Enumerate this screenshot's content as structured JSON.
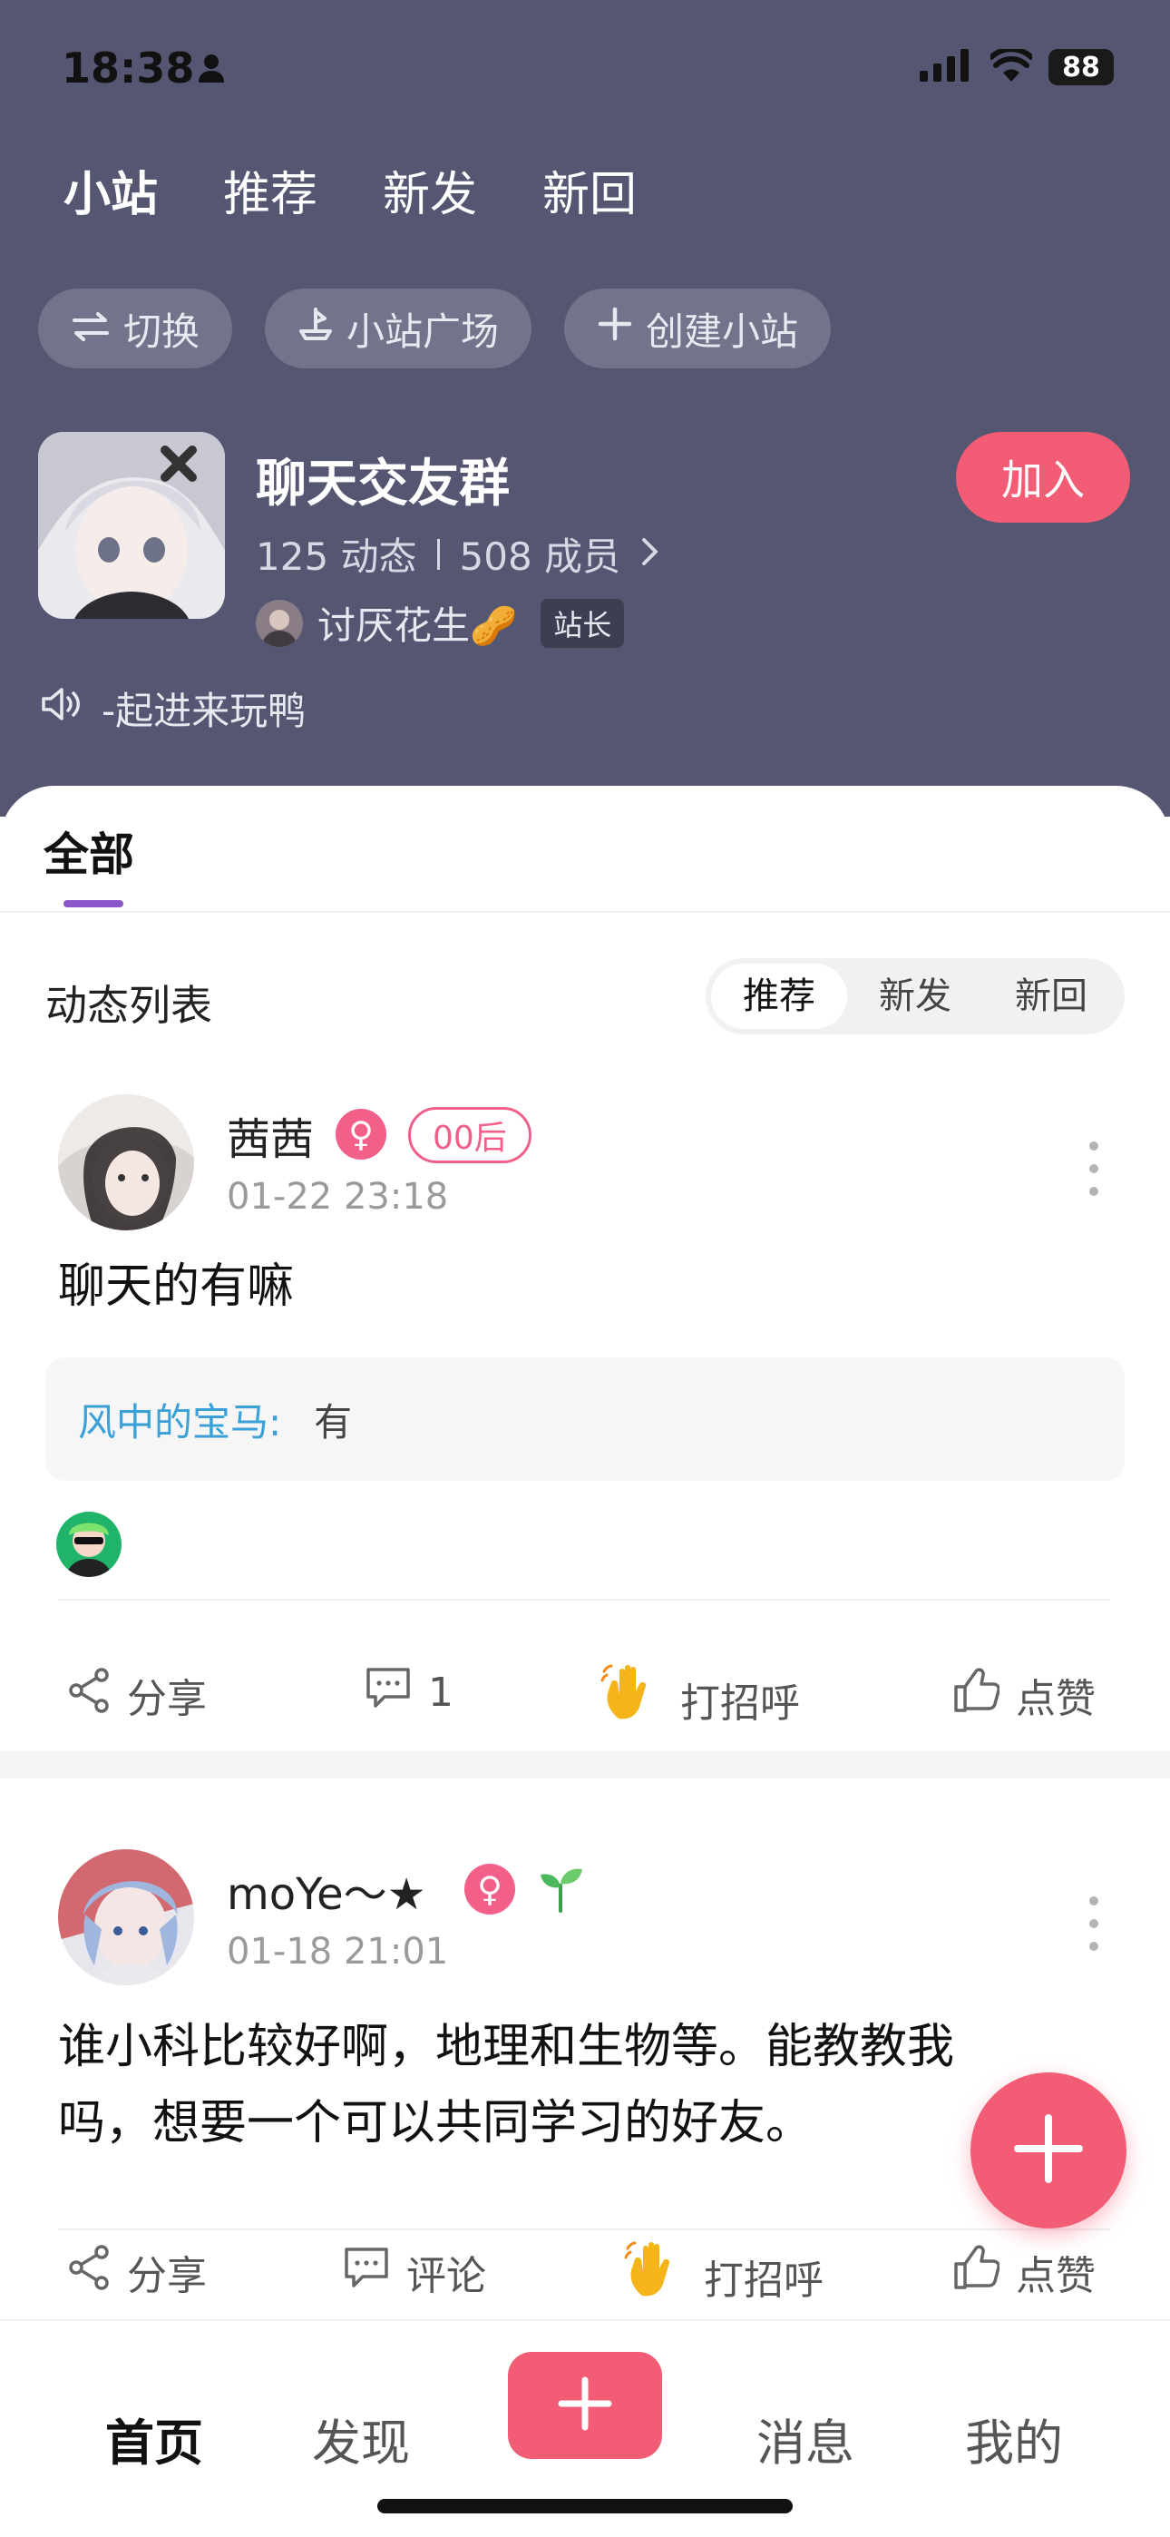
{
  "status_bar": {
    "time": "18:38",
    "battery": "88"
  },
  "top_tabs": [
    {
      "label": "小站"
    },
    {
      "label": "推荐"
    },
    {
      "label": "新发"
    },
    {
      "label": "新回"
    }
  ],
  "pills": [
    {
      "label": "切换",
      "icon": "swap-icon"
    },
    {
      "label": "小站广场",
      "icon": "ship-icon"
    },
    {
      "label": "创建小站",
      "icon": "plus-icon"
    }
  ],
  "group": {
    "title": "聊天交友群",
    "posts_count": "125 动态",
    "members_count": "508 成员",
    "owner_name": "讨厌花生🥜",
    "owner_badge": "站长",
    "join_label": "加入",
    "announcement": "-起进来玩鸭"
  },
  "content_tabs": {
    "all_label": "全部"
  },
  "feed": {
    "label": "动态列表",
    "sort_options": [
      "推荐",
      "新发",
      "新回"
    ],
    "selected_sort": "推荐"
  },
  "posts": [
    {
      "name": "茜茜",
      "gender_symbol": "♀",
      "age_tag": "00后",
      "time": "01-22 23:18",
      "text": "聊天的有嘛",
      "reply": {
        "name": "风中的宝马:",
        "text": "有"
      },
      "actions": {
        "share": "分享",
        "comment": "1",
        "greet": "打招呼",
        "like": "点赞"
      }
    },
    {
      "name": "moYe～★",
      "gender_symbol": "♀",
      "time": "01-18 21:01",
      "text_line1": "谁小科比较好啊，地理和生物等。能教教我",
      "text_line2": "吗，想要一个可以共同学习的好友。",
      "actions": {
        "share": "分享",
        "comment": "评论",
        "greet": "打招呼",
        "like": "点赞"
      }
    }
  ],
  "bottom_nav": [
    {
      "label": "首页"
    },
    {
      "label": "发现"
    },
    {
      "label": "消息"
    },
    {
      "label": "我的"
    }
  ],
  "colors": {
    "header_bg": "#545672",
    "accent_pink": "#f25c74",
    "tab_underline": "#8a55c9",
    "reply_name": "#3aa0d8"
  }
}
